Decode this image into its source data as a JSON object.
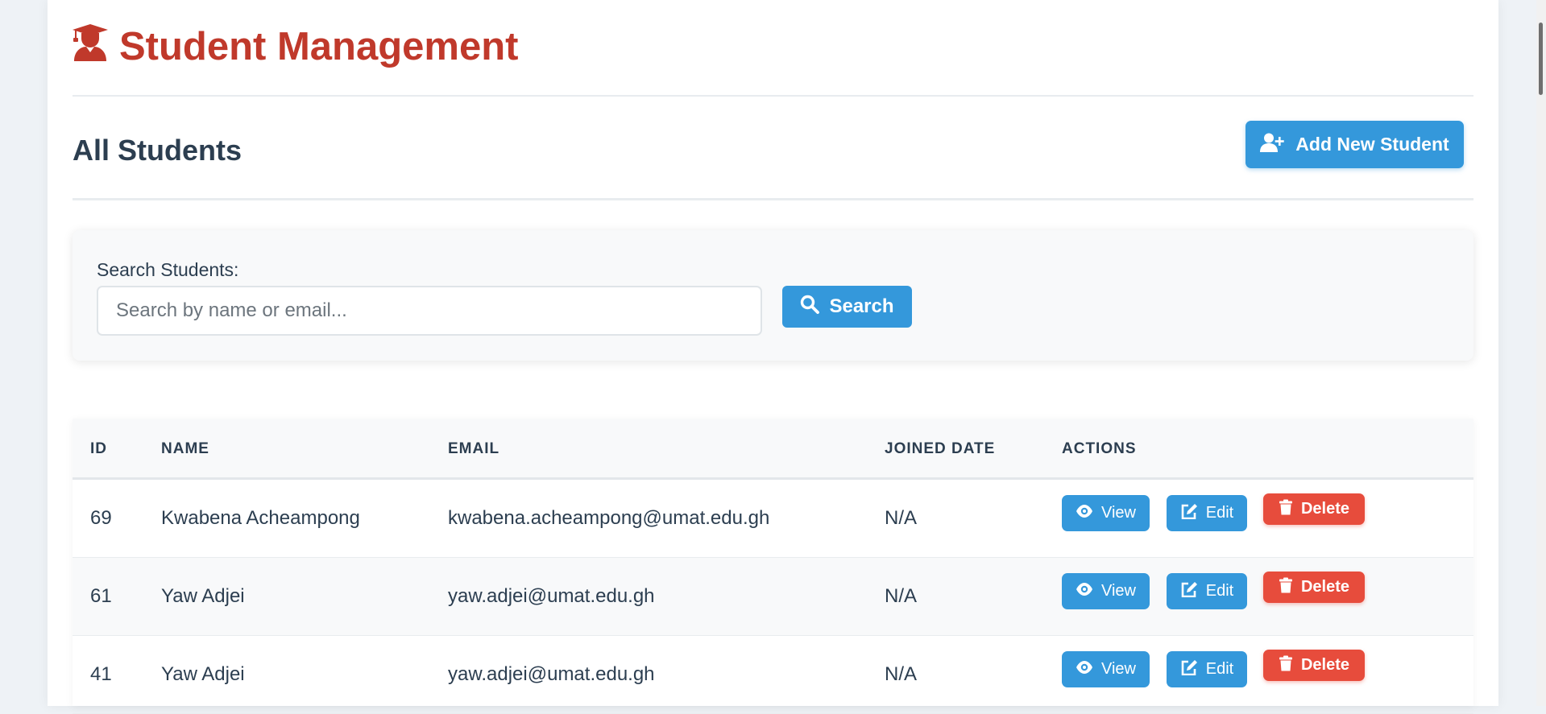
{
  "app": {
    "title": "Student Management",
    "title_color": "#c0392b",
    "title_icon": "user-graduate-icon"
  },
  "section": {
    "title": "All Students",
    "add_button_label": "Add New Student",
    "add_button_icon": "user-plus-icon"
  },
  "search": {
    "label": "Search Students:",
    "placeholder": "Search by name or email...",
    "value": "",
    "button_label": "Search",
    "button_icon": "search-icon"
  },
  "table": {
    "columns": [
      "ID",
      "NAME",
      "EMAIL",
      "JOINED DATE",
      "ACTIONS"
    ],
    "rows": [
      {
        "id": "69",
        "name": "Kwabena Acheampong",
        "email": "kwabena.acheampong@umat.edu.gh",
        "joined": "N/A"
      },
      {
        "id": "61",
        "name": "Yaw Adjei",
        "email": "yaw.adjei@umat.edu.gh",
        "joined": "N/A"
      },
      {
        "id": "41",
        "name": "Yaw Adjei",
        "email": "yaw.adjei@umat.edu.gh",
        "joined": "N/A"
      }
    ],
    "actions": {
      "view": "View",
      "edit": "Edit",
      "delete": "Delete"
    }
  },
  "colors": {
    "primary": "#3498db",
    "danger": "#e74c3c",
    "heading": "#2c3e50"
  }
}
